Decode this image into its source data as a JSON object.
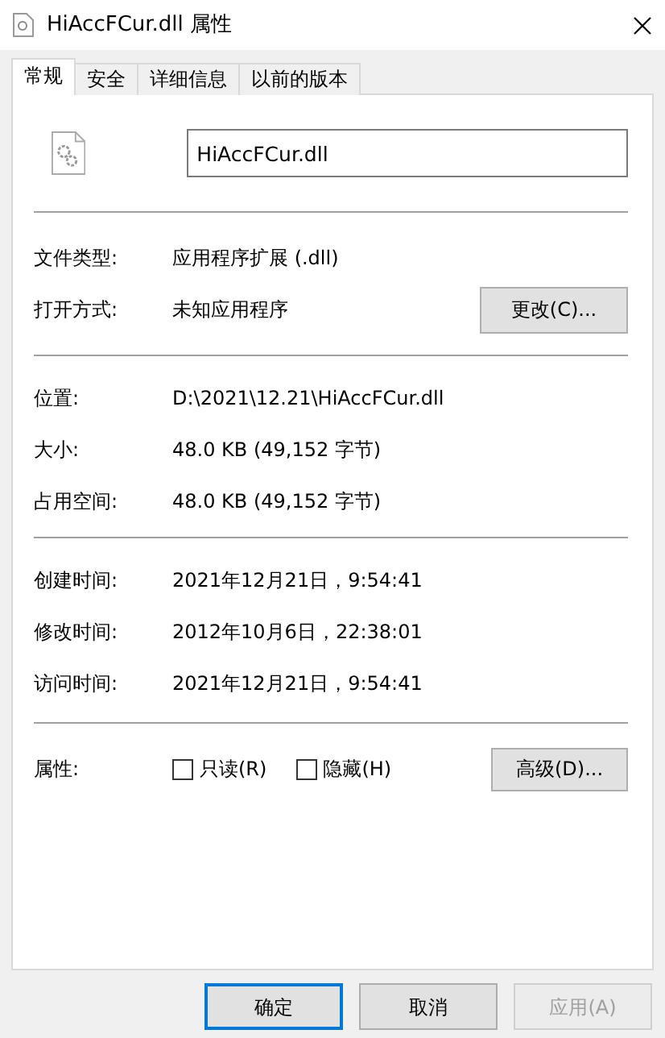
{
  "window": {
    "title": "HiAccFCur.dll 属性"
  },
  "tabs": [
    {
      "label": "常规",
      "selected": true
    },
    {
      "label": "安全",
      "selected": false
    },
    {
      "label": "详细信息",
      "selected": false
    },
    {
      "label": "以前的版本",
      "selected": false
    }
  ],
  "file_name": {
    "value": "HiAccFCur.dll"
  },
  "sections": [
    {
      "rows": [
        {
          "label": "文件类型:",
          "value": "应用程序扩展 (.dll)"
        },
        {
          "label": "打开方式:",
          "value": "未知应用程序",
          "button": "更改(C)..."
        }
      ]
    },
    {
      "rows": [
        {
          "label": "位置:",
          "value": "D:\\2021\\12.21\\HiAccFCur.dll"
        },
        {
          "label": "大小:",
          "value": "48.0 KB (49,152 字节)"
        },
        {
          "label": "占用空间:",
          "value": "48.0 KB (49,152 字节)"
        }
      ]
    },
    {
      "rows": [
        {
          "label": "创建时间:",
          "value": "2021年12月21日，9:54:41"
        },
        {
          "label": "修改时间:",
          "value": "2012年10月6日，22:38:01"
        },
        {
          "label": "访问时间:",
          "value": "2021年12月21日，9:54:41"
        }
      ]
    }
  ],
  "attributes": {
    "label": "属性:",
    "checkboxes": [
      {
        "label": "只读(R)",
        "checked": false
      },
      {
        "label": "隐藏(H)",
        "checked": false
      }
    ],
    "button": "高级(D)..."
  },
  "buttons": [
    {
      "label": "确定",
      "default": true,
      "disabled": false
    },
    {
      "label": "取消",
      "default": false,
      "disabled": false
    },
    {
      "label": "应用(A)",
      "default": false,
      "disabled": true
    }
  ]
}
